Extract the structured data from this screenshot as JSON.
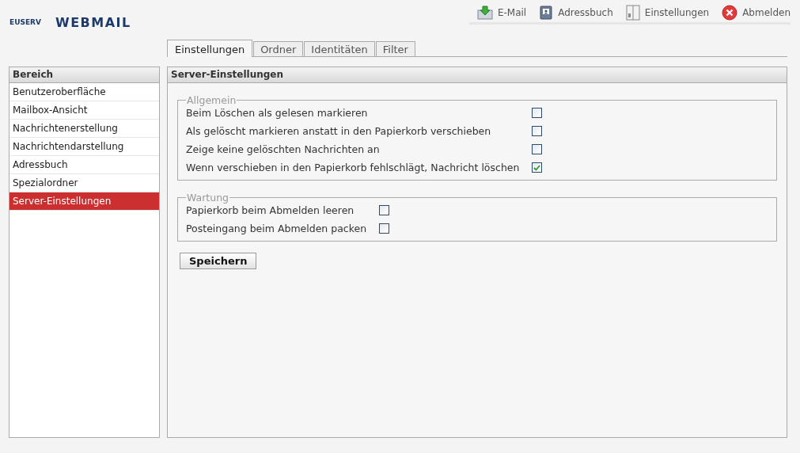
{
  "logo": {
    "mark": "EUSERV",
    "title": "WEBMAIL"
  },
  "topnav": [
    {
      "kind": "mail",
      "label": "E-Mail"
    },
    {
      "kind": "book",
      "label": "Adressbuch"
    },
    {
      "kind": "settings",
      "label": "Einstellungen"
    },
    {
      "kind": "logout",
      "label": "Abmelden"
    }
  ],
  "tabs": [
    {
      "label": "Einstellungen",
      "selected": true
    },
    {
      "label": "Ordner",
      "selected": false
    },
    {
      "label": "Identitäten",
      "selected": false
    },
    {
      "label": "Filter",
      "selected": false
    }
  ],
  "sidebar": {
    "title": "Bereich",
    "items": [
      {
        "label": "Benutzeroberfläche",
        "selected": false
      },
      {
        "label": "Mailbox-Ansicht",
        "selected": false
      },
      {
        "label": "Nachrichtenerstellung",
        "selected": false
      },
      {
        "label": "Nachrichtendarstellung",
        "selected": false
      },
      {
        "label": "Adressbuch",
        "selected": false
      },
      {
        "label": "Spezialordner",
        "selected": false
      },
      {
        "label": "Server-Einstellungen",
        "selected": true
      }
    ]
  },
  "panel": {
    "title": "Server-Einstellungen",
    "sections": [
      {
        "legend": "Allgemein",
        "options": [
          {
            "label": "Beim Löschen als gelesen markieren",
            "checked": false
          },
          {
            "label": "Als gelöscht markieren anstatt in den Papierkorb verschieben",
            "checked": false
          },
          {
            "label": "Zeige keine gelöschten Nachrichten an",
            "checked": false
          },
          {
            "label": "Wenn verschieben in den Papierkorb fehlschlägt, Nachricht löschen",
            "checked": true
          }
        ]
      },
      {
        "legend": "Wartung",
        "options": [
          {
            "label": "Papierkorb beim Abmelden leeren",
            "checked": false
          },
          {
            "label": "Posteingang beim Abmelden packen",
            "checked": false
          }
        ]
      }
    ],
    "save": "Speichern"
  }
}
